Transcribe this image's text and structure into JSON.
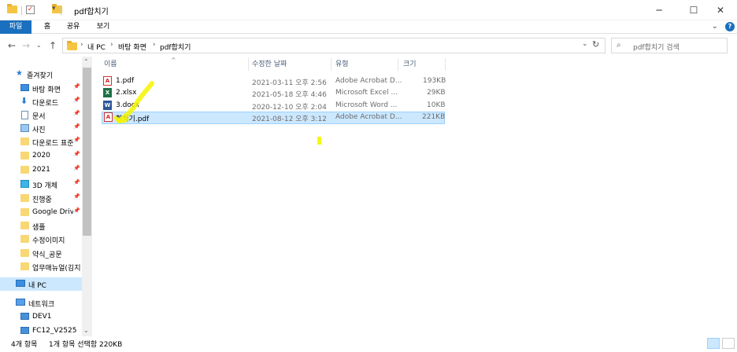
{
  "window": {
    "title": "pdf합치기",
    "controls": {
      "minimize": "─",
      "maximize": "☐",
      "close": "✕"
    }
  },
  "ribbon": {
    "tabs": [
      "파일",
      "홈",
      "공유",
      "보기"
    ],
    "expand_icon": "chevron-down-icon",
    "help_label": "?"
  },
  "address": {
    "breadcrumb": [
      "내 PC",
      "바탕 화면",
      "pdf합치기"
    ],
    "search_placeholder": "pdf합치기 검색"
  },
  "sidebar": {
    "quick_access": "즐겨찾기",
    "items": [
      {
        "label": "바탕 화면",
        "icon": "desktop-icon",
        "pinned": true
      },
      {
        "label": "다운로드",
        "icon": "download-icon",
        "pinned": true
      },
      {
        "label": "문서",
        "icon": "documents-icon",
        "pinned": true
      },
      {
        "label": "사진",
        "icon": "pictures-icon",
        "pinned": true
      },
      {
        "label": "다운로드 표준",
        "icon": "folder-icon",
        "pinned": true
      },
      {
        "label": "2020",
        "icon": "folder-icon",
        "pinned": true
      },
      {
        "label": "2021",
        "icon": "folder-icon",
        "pinned": true
      },
      {
        "label": "3D 개체",
        "icon": "3d-objects-icon",
        "pinned": true
      },
      {
        "label": "진행중",
        "icon": "folder-icon",
        "pinned": true
      },
      {
        "label": "Google Drive",
        "icon": "folder-icon",
        "pinned": true
      },
      {
        "label": "샘플",
        "icon": "folder-icon",
        "pinned": false
      },
      {
        "label": "수정이미지",
        "icon": "folder-icon",
        "pinned": false
      },
      {
        "label": "약식_공문",
        "icon": "folder-icon",
        "pinned": false
      },
      {
        "label": "업무매뉴얼(김지",
        "icon": "folder-icon",
        "pinned": false
      }
    ],
    "this_pc": "내 PC",
    "network": "네트워크",
    "network_items": [
      "DEV1",
      "FC12_V2525"
    ]
  },
  "columns": {
    "name": "이름",
    "date": "수정한 날짜",
    "type": "유형",
    "size": "크기"
  },
  "files": [
    {
      "name": "1.pdf",
      "kind": "pdf",
      "date": "2021-03-11 오후 2:56",
      "type": "Adobe Acrobat D...",
      "size": "193KB",
      "selected": false
    },
    {
      "name": "2.xlsx",
      "kind": "xlsx",
      "date": "2021-05-18 오후 4:46",
      "type": "Microsoft Excel ...",
      "size": "29KB",
      "selected": false
    },
    {
      "name": "3.docx",
      "kind": "docx",
      "date": "2020-12-10 오후 2:04",
      "type": "Microsoft Word ...",
      "size": "10KB",
      "selected": false
    },
    {
      "name": "합치기.pdf",
      "kind": "pdf",
      "date": "2021-08-12 오후 3:12",
      "type": "Adobe Acrobat D...",
      "size": "221KB",
      "selected": true
    }
  ],
  "status": {
    "item_count": "4개 항목",
    "selection": "1개 항목 선택함 220KB"
  },
  "colors": {
    "accent": "#1a6fbe",
    "selection": "#cce8ff",
    "highlighter": "#f5f500"
  }
}
